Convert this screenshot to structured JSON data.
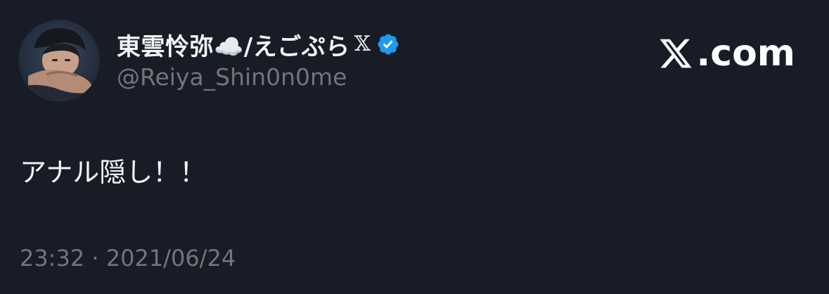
{
  "author": {
    "display_name": "東雲怜弥☁️/えごぷら",
    "platform_badge": "𝕏",
    "handle": "@Reiya_Shin0n0me",
    "verified": true,
    "verified_color": "#1d9bf0"
  },
  "brand": {
    "label": ".com",
    "icon": "x-logo-icon"
  },
  "tweet": {
    "text": "アナル隠し！！",
    "timestamp": "23:32 · 2021/06/24"
  },
  "colors": {
    "background": "#171c26",
    "secondary_text": "#71767b",
    "primary_text": "#f4f5f6"
  }
}
